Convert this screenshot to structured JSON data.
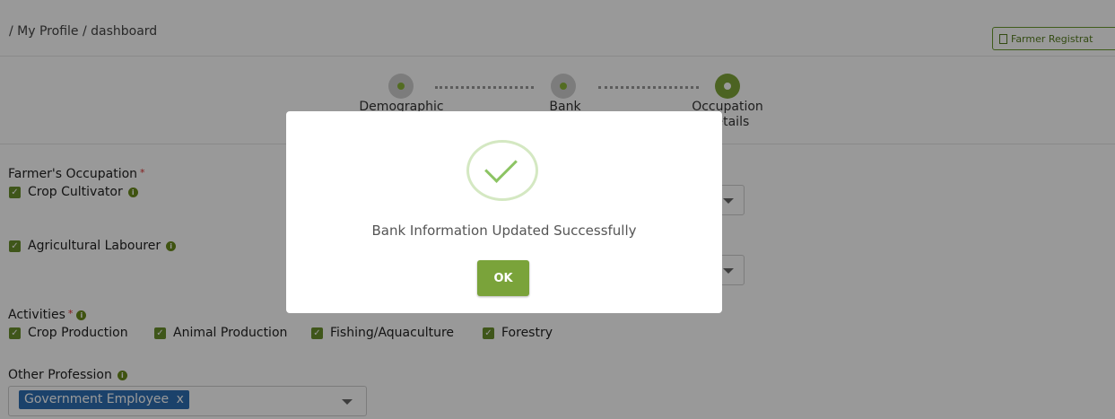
{
  "breadcrumb": "/ My Profile / dashboard",
  "header": {
    "register_label": "Farmer Registrat"
  },
  "stepper": {
    "steps": [
      {
        "label": "Demographic",
        "state": "done"
      },
      {
        "label": "Bank",
        "state": "done"
      },
      {
        "label": "Occupation\nDetails",
        "state": "active"
      }
    ]
  },
  "form": {
    "occupation_label": "Farmer's Occupation",
    "required_mark": "*",
    "occupations": [
      "Crop Cultivator",
      "Agricultural Labourer"
    ],
    "activities_label": "Activities",
    "activities": [
      "Crop Production",
      "Animal Production",
      "Fishing/Aquaculture",
      "Forestry"
    ],
    "other_profession_label": "Other Profession",
    "other_profession_value": "Government Employee",
    "chip_remove": "x"
  },
  "modal": {
    "message": "Bank Information Updated Successfully",
    "ok_label": "OK"
  },
  "colors": {
    "accent": "#7aa33a",
    "chip": "#2e6fb3",
    "overlay": "rgba(0,0,0,0.40)"
  }
}
